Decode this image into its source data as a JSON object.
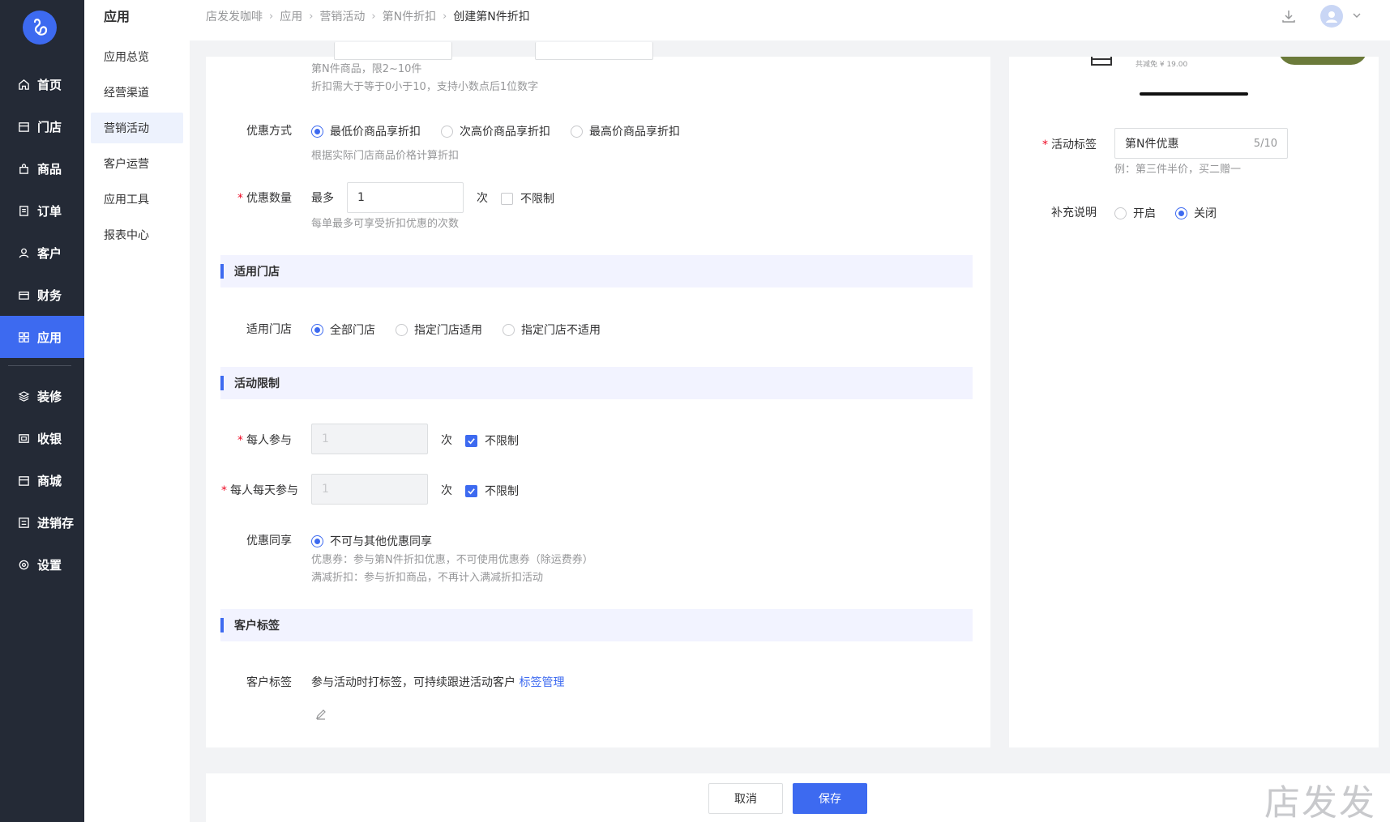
{
  "nav": {
    "items": [
      {
        "label": "首页",
        "icon": "home-icon"
      },
      {
        "label": "门店",
        "icon": "store-icon"
      },
      {
        "label": "商品",
        "icon": "bag-icon"
      },
      {
        "label": "订单",
        "icon": "order-icon"
      },
      {
        "label": "客户",
        "icon": "user-icon"
      },
      {
        "label": "财务",
        "icon": "wallet-icon"
      },
      {
        "label": "应用",
        "icon": "apps-icon"
      },
      {
        "label": "装修",
        "icon": "layers-icon"
      },
      {
        "label": "收银",
        "icon": "cashier-icon"
      },
      {
        "label": "商城",
        "icon": "mall-icon"
      },
      {
        "label": "进销存",
        "icon": "inventory-icon"
      },
      {
        "label": "设置",
        "icon": "settings-icon"
      }
    ],
    "active": "应用"
  },
  "subnav": {
    "title": "应用",
    "items": [
      "应用总览",
      "经营渠道",
      "营销活动",
      "客户运营",
      "应用工具",
      "报表中心"
    ],
    "active": "营销活动"
  },
  "breadcrumb": [
    "店发发咖啡",
    "应用",
    "营销活动",
    "第N件折扣",
    "创建第N件折扣"
  ],
  "form": {
    "nth_hint1": "第N件商品，限2~10件",
    "nth_hint2": "折扣需大于等于0小于10，支持小数点后1位数字",
    "discount_mode": {
      "label": "优惠方式",
      "options": [
        "最低价商品享折扣",
        "次高价商品享折扣",
        "最高价商品享折扣"
      ],
      "selected": 0,
      "hint": "根据实际门店商品价格计算折扣"
    },
    "discount_count": {
      "label": "优惠数量",
      "prefix": "最多",
      "value": "1",
      "unit": "次",
      "unlimited_label": "不限制",
      "unlimited": false,
      "hint": "每单最多可享受折扣优惠的次数"
    },
    "store_section": "适用门店",
    "stores": {
      "label": "适用门店",
      "options": [
        "全部门店",
        "指定门店适用",
        "指定门店不适用"
      ],
      "selected": 0
    },
    "limit_section": "活动限制",
    "per_person": {
      "label": "每人参与",
      "value": "1",
      "unit": "次",
      "unlimited_label": "不限制",
      "unlimited": true
    },
    "per_person_day": {
      "label": "每人每天参与",
      "value": "1",
      "unit": "次",
      "unlimited_label": "不限制",
      "unlimited": true
    },
    "share": {
      "label": "优惠同享",
      "option": "不可与其他优惠同享",
      "hint1": "优惠券：参与第N件折扣优惠，不可使用优惠券（除运费券）",
      "hint2": "满减折扣：参与折扣商品，不再计入满减折扣活动"
    },
    "tag_section": "客户标签",
    "customer_tag": {
      "label": "客户标签",
      "text": "参与活动时打标签，可持续跟进活动客户",
      "link": "标签管理"
    }
  },
  "preview": {
    "saving": "共减免 ¥ 19.00"
  },
  "side": {
    "activity_tag": {
      "label": "活动标签",
      "value": "第N件优惠",
      "counter": "5/10",
      "hint": "例：第三件半价，买二赠一"
    },
    "supplement": {
      "label": "补充说明",
      "options": [
        "开启",
        "关闭"
      ],
      "selected": 1
    }
  },
  "actions": {
    "cancel": "取消",
    "save": "保存"
  },
  "watermark": "店发发",
  "colors": {
    "primary": "#3d6af0",
    "nav_bg": "#242a36",
    "required": "#ee0a24",
    "section_bg": "#f2f3ff"
  }
}
